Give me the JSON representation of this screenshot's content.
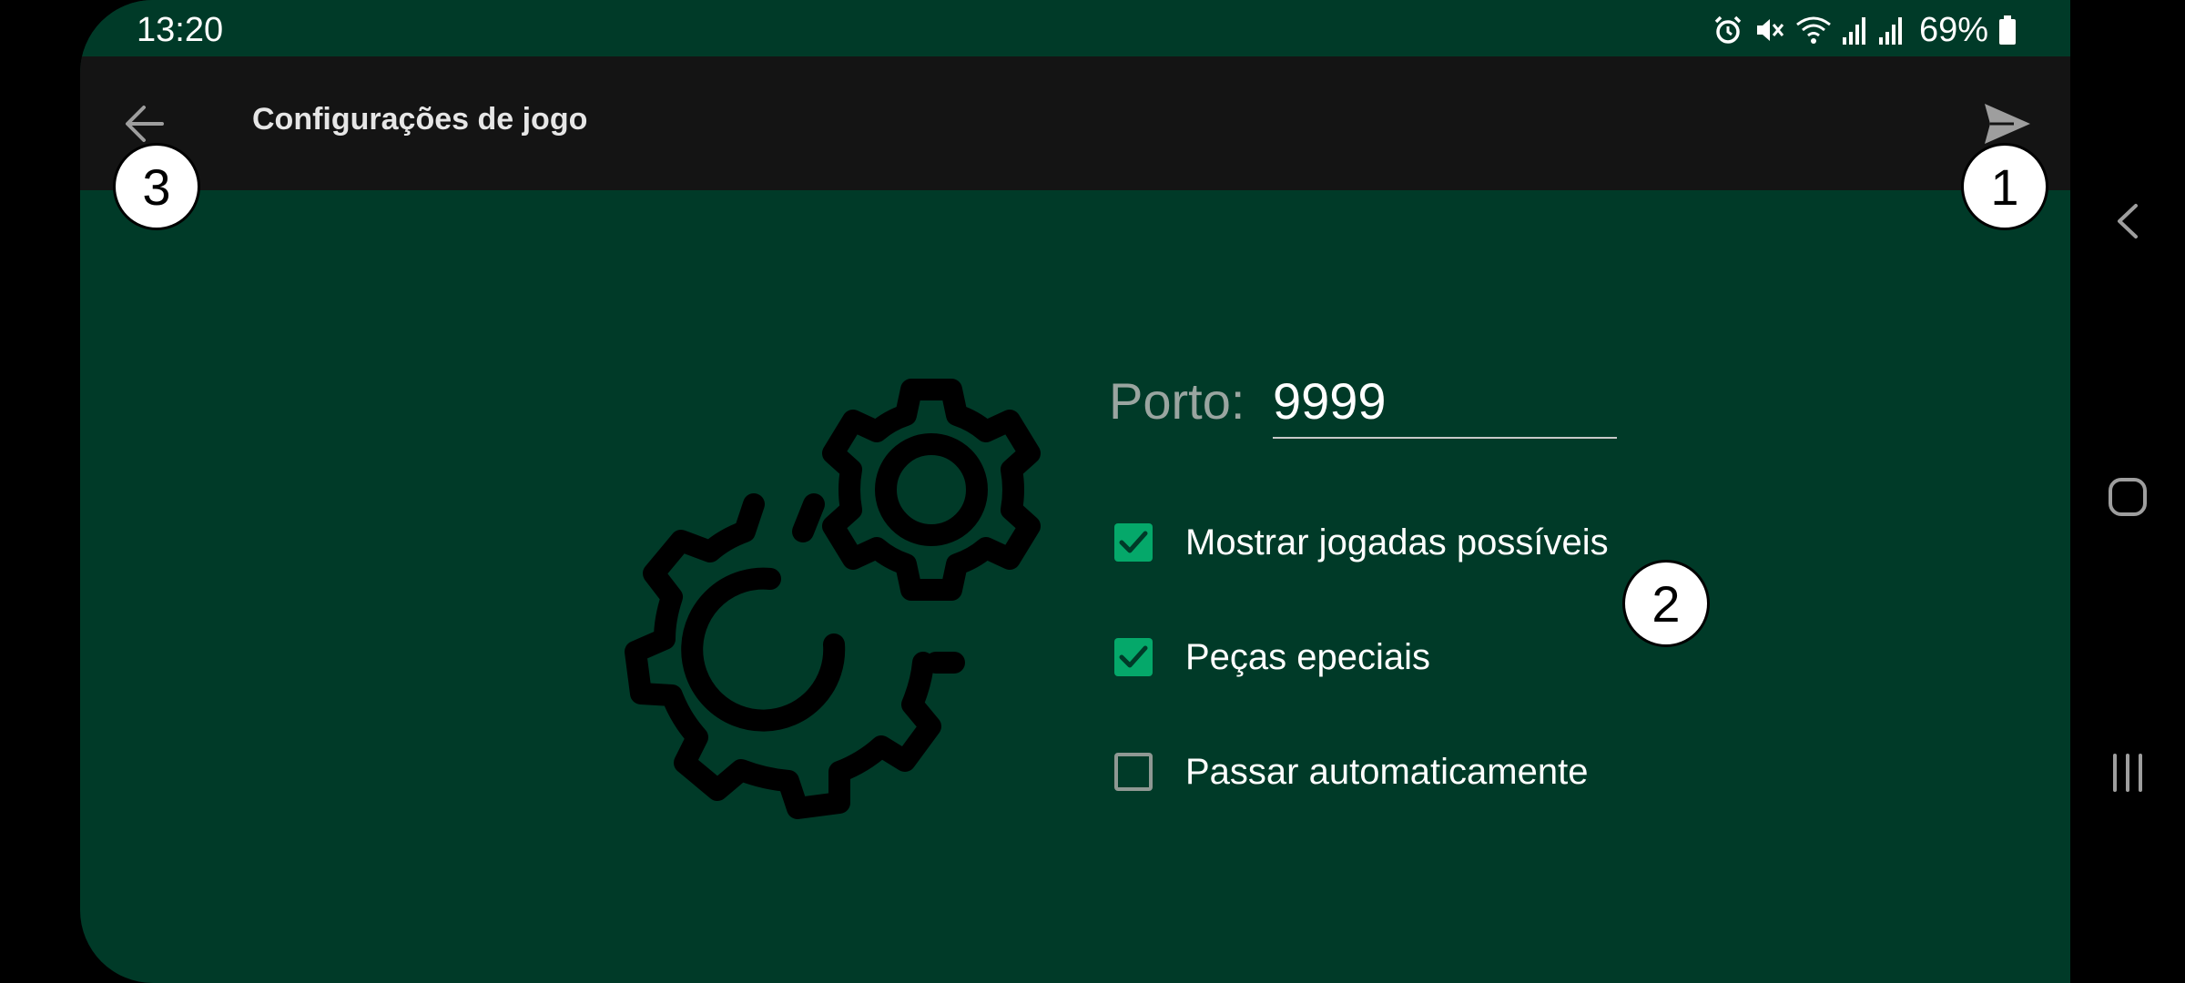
{
  "status_bar": {
    "time": "13:20",
    "battery": "69%",
    "icons": [
      "alarm-icon",
      "mute-icon",
      "wifi-icon",
      "signal-icon",
      "signal-icon",
      "battery-icon"
    ]
  },
  "app_bar": {
    "title": "Configurações de jogo",
    "back_icon": "arrow-left-icon",
    "send_icon": "send-icon"
  },
  "settings": {
    "port_label": "Porto:",
    "port_value": "9999",
    "options": [
      {
        "label": "Mostrar jogadas possíveis",
        "checked": true
      },
      {
        "label": "Peças epeciais",
        "checked": true
      },
      {
        "label": "Passar automaticamente",
        "checked": false
      }
    ]
  },
  "badges": {
    "one": "1",
    "two": "2",
    "three": "3"
  },
  "nav_bar": {
    "icons": [
      "back-chevron-icon",
      "home-icon",
      "recents-icon"
    ]
  },
  "colors": {
    "background": "#003a28",
    "app_bar": "#141414",
    "checkbox_accent": "#05a86a"
  }
}
